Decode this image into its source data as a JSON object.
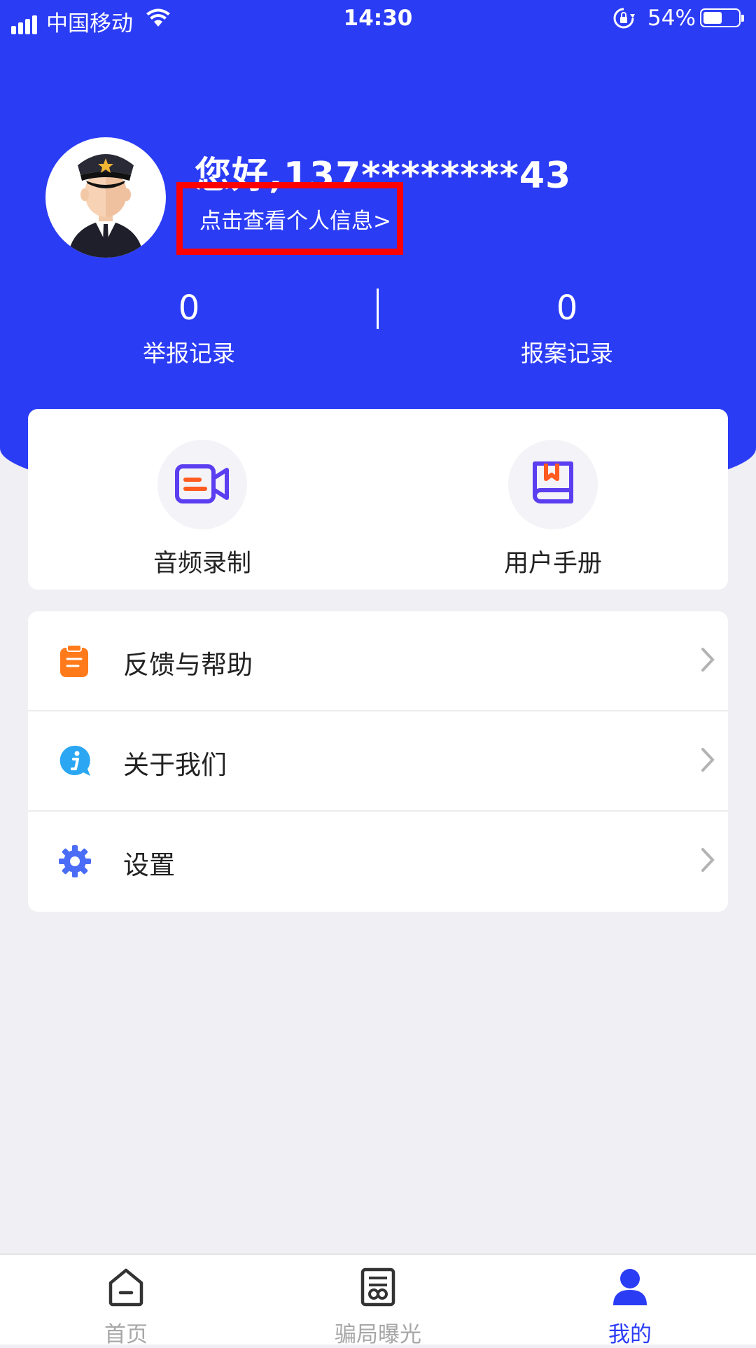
{
  "status_bar": {
    "carrier": "中国移动",
    "time": "14:30",
    "battery_percent": "54%",
    "battery_level": 0.54
  },
  "profile": {
    "greeting": "您好,137********43",
    "info_link": "点击查看个人信息>",
    "avatar": "police-officer-avatar"
  },
  "stats": [
    {
      "value": "0",
      "label": "举报记录"
    },
    {
      "value": "0",
      "label": "报案记录"
    }
  ],
  "tools": [
    {
      "label": "音频录制",
      "icon": "video-record-icon"
    },
    {
      "label": "用户手册",
      "icon": "manual-book-icon"
    }
  ],
  "menu": [
    {
      "label": "反馈与帮助",
      "icon": "clipboard-icon"
    },
    {
      "label": "关于我们",
      "icon": "info-bubble-icon"
    },
    {
      "label": "设置",
      "icon": "gear-icon"
    }
  ],
  "nav": [
    {
      "label": "首页",
      "icon": "home-icon",
      "active": false
    },
    {
      "label": "骗局曝光",
      "icon": "news-icon",
      "active": false
    },
    {
      "label": "我的",
      "icon": "person-icon",
      "active": true
    }
  ],
  "colors": {
    "primary": "#2b3cf5",
    "highlight_box": "#ff0000",
    "feedback_icon": "#ff7a1a",
    "about_icon": "#2aa6f2",
    "settings_icon": "#4a6cf7"
  }
}
